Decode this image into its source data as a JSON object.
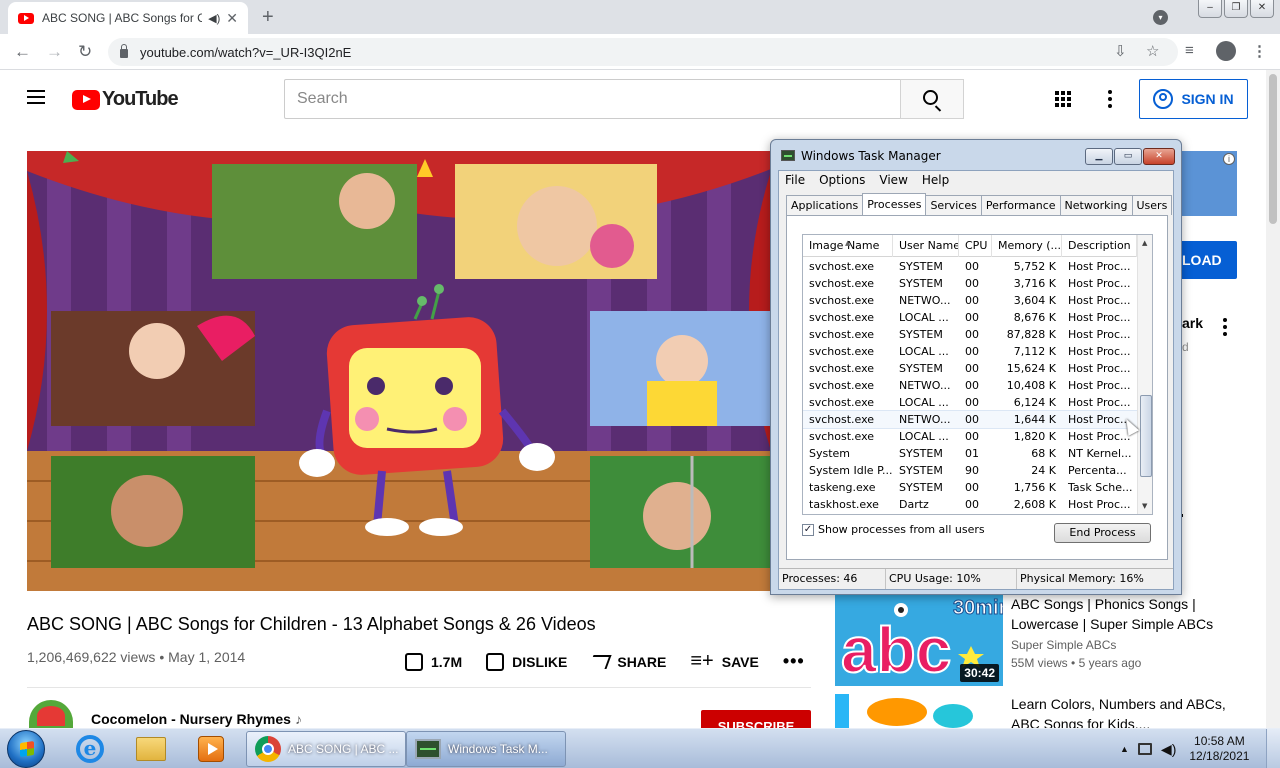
{
  "browser": {
    "tab_title": "ABC SONG | ABC Songs for Children",
    "url": "youtube.com/watch?v=_UR-I3QI2nE"
  },
  "youtube": {
    "logo_text": "YouTube",
    "search_placeholder": "Search",
    "sign_in_label": "SIGN IN",
    "brand_red": "#ff0000",
    "link_blue": "#065fd4"
  },
  "video": {
    "title": "ABC SONG | ABC Songs for Children - 13 Alphabet Songs & 26 Videos",
    "views": "1,206,469,622 views",
    "date": "May 1, 2014",
    "like_count": "1.7M",
    "dislike_label": "DISLIKE",
    "share_label": "SHARE",
    "save_label": "SAVE",
    "channel_name": "Cocomelon - Nursery Rhymes",
    "subscribe_label": "SUBSCRIBE"
  },
  "sidebar": {
    "download_label": "LOAD",
    "partial_title": "ark",
    "partial_meta": "d",
    "recommendations": [
      {
        "title": "ABC Songs | Phonics Songs | Lowercase | Super Simple ABCs",
        "channel": "Super Simple ABCs",
        "views": "55M views",
        "age": "5 years ago",
        "duration": "30:42",
        "thumb_badge": "30min!",
        "thumb_text": "abc"
      },
      {
        "title": "Learn Colors, Numbers and ABCs, ABC Songs for Kids,..."
      }
    ]
  },
  "task_manager": {
    "title": "Windows Task Manager",
    "menu": [
      "File",
      "Options",
      "View",
      "Help"
    ],
    "tabs": [
      "Applications",
      "Processes",
      "Services",
      "Performance",
      "Networking",
      "Users"
    ],
    "active_tab": "Processes",
    "columns": [
      "Image Name",
      "User Name",
      "CPU",
      "Memory (...",
      "Description"
    ],
    "processes": [
      {
        "name": "svchost.exe",
        "user": "SYSTEM",
        "cpu": "00",
        "mem": "5,752 K",
        "desc": "Host Proc..."
      },
      {
        "name": "svchost.exe",
        "user": "SYSTEM",
        "cpu": "00",
        "mem": "3,716 K",
        "desc": "Host Proc..."
      },
      {
        "name": "svchost.exe",
        "user": "NETWO...",
        "cpu": "00",
        "mem": "3,604 K",
        "desc": "Host Proc..."
      },
      {
        "name": "svchost.exe",
        "user": "LOCAL ...",
        "cpu": "00",
        "mem": "8,676 K",
        "desc": "Host Proc..."
      },
      {
        "name": "svchost.exe",
        "user": "SYSTEM",
        "cpu": "00",
        "mem": "87,828 K",
        "desc": "Host Proc..."
      },
      {
        "name": "svchost.exe",
        "user": "LOCAL ...",
        "cpu": "00",
        "mem": "7,112 K",
        "desc": "Host Proc..."
      },
      {
        "name": "svchost.exe",
        "user": "SYSTEM",
        "cpu": "00",
        "mem": "15,624 K",
        "desc": "Host Proc..."
      },
      {
        "name": "svchost.exe",
        "user": "NETWO...",
        "cpu": "00",
        "mem": "10,408 K",
        "desc": "Host Proc..."
      },
      {
        "name": "svchost.exe",
        "user": "LOCAL ...",
        "cpu": "00",
        "mem": "6,124 K",
        "desc": "Host Proc..."
      },
      {
        "name": "svchost.exe",
        "user": "NETWO...",
        "cpu": "00",
        "mem": "1,644 K",
        "desc": "Host Proc..."
      },
      {
        "name": "svchost.exe",
        "user": "LOCAL ...",
        "cpu": "00",
        "mem": "1,820 K",
        "desc": "Host Proc..."
      },
      {
        "name": "System",
        "user": "SYSTEM",
        "cpu": "01",
        "mem": "68 K",
        "desc": "NT Kernel..."
      },
      {
        "name": "System Idle P...",
        "user": "SYSTEM",
        "cpu": "90",
        "mem": "24 K",
        "desc": "Percenta..."
      },
      {
        "name": "taskeng.exe",
        "user": "SYSTEM",
        "cpu": "00",
        "mem": "1,756 K",
        "desc": "Task Sche..."
      },
      {
        "name": "taskhost.exe",
        "user": "Dartz",
        "cpu": "00",
        "mem": "2,608 K",
        "desc": "Host Proc..."
      }
    ],
    "show_all_label": "Show processes from all users",
    "show_all_checked": true,
    "end_process_label": "End Process",
    "status_processes": "Processes: 46",
    "status_cpu": "CPU Usage: 10%",
    "status_memory": "Physical Memory: 16%"
  },
  "taskbar": {
    "tasks": [
      {
        "label": "ABC SONG | ABC ..."
      },
      {
        "label": "Windows Task M..."
      }
    ],
    "time": "10:58 AM",
    "date": "12/18/2021"
  }
}
